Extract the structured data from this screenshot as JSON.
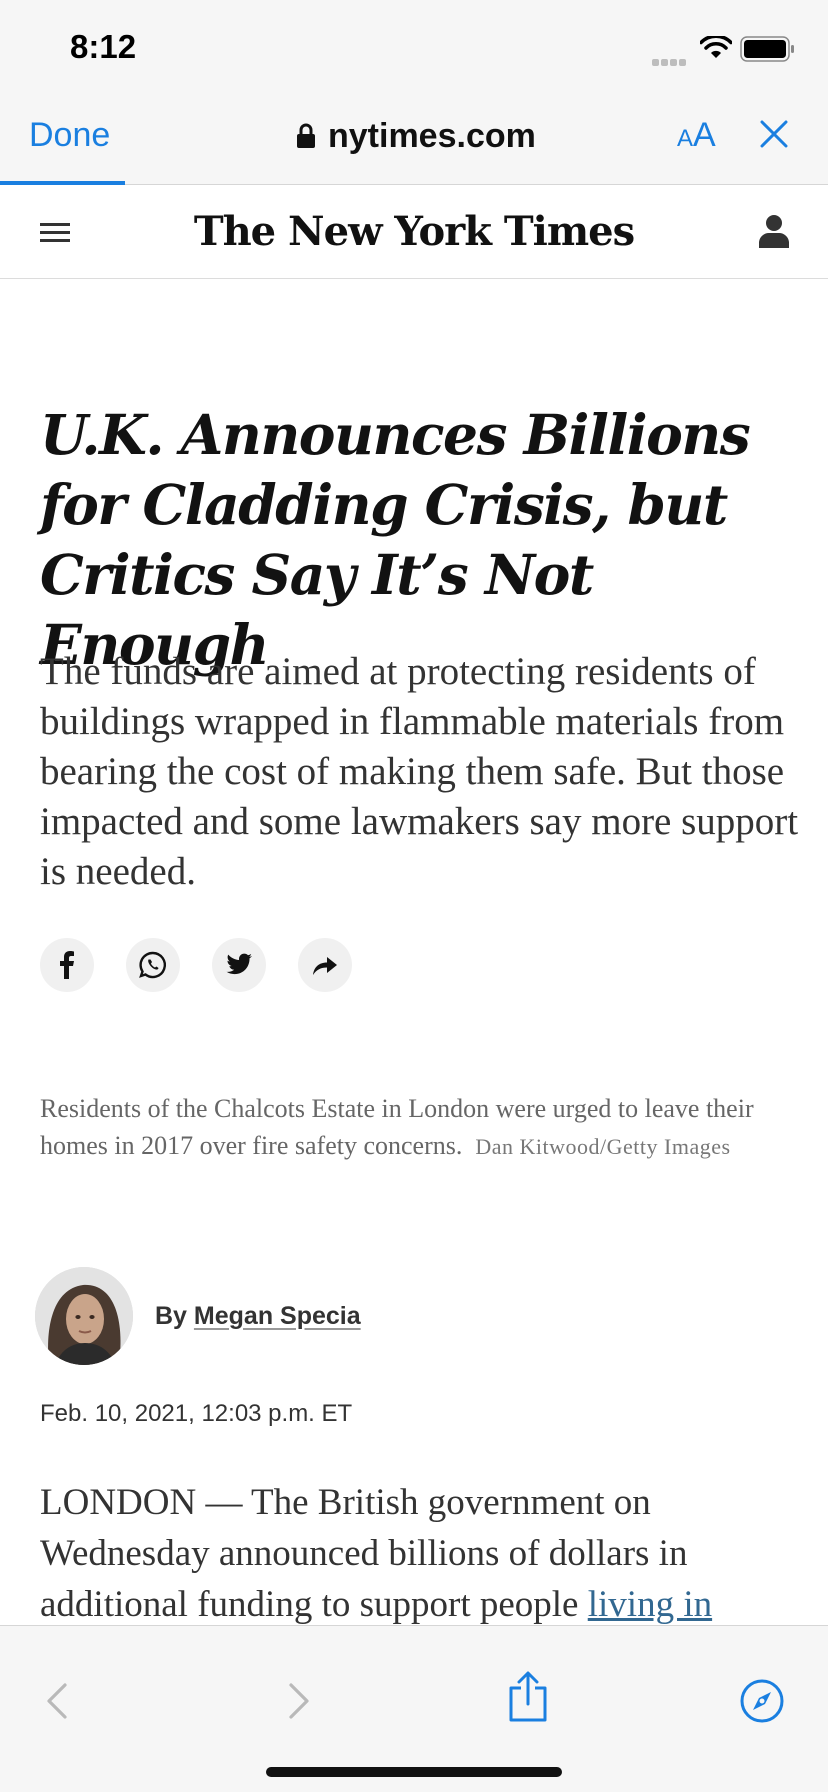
{
  "status_bar": {
    "time": "8:12"
  },
  "browser": {
    "done_label": "Done",
    "url": "nytimes.com",
    "text_size_small": "A",
    "text_size_large": "A"
  },
  "site": {
    "logo": "The New York Times"
  },
  "article": {
    "headline": "U.K. Announces Billions for Cladding Crisis, but Critics Say It’s Not Enough",
    "summary": "The funds are aimed at protecting residents of buildings wrapped in flammable materials from bearing the cost of making them safe. But those impacted and some lawmakers say more support is needed.",
    "caption": "Residents of the Chalcots Estate in London were urged to leave their homes in 2017 over fire safety concerns.",
    "credit": "Dan Kitwood/Getty Images",
    "byline_prefix": "By",
    "author": "Megan Specia",
    "date": "Feb. 10, 2021, 12:03 p.m. ET",
    "body_text": "LONDON — The British government on Wednesday announced billions of dollars in additional funding to support people",
    "body_link": "living in"
  },
  "share_icons": [
    "facebook-icon",
    "whatsapp-icon",
    "twitter-icon",
    "share-arrow-icon"
  ],
  "toolbar_icons": [
    "back-icon",
    "forward-icon",
    "share-icon",
    "compass-icon"
  ],
  "colors": {
    "accent": "#1a7fe0",
    "link": "#326891",
    "chrome_bg": "#f6f6f6"
  }
}
